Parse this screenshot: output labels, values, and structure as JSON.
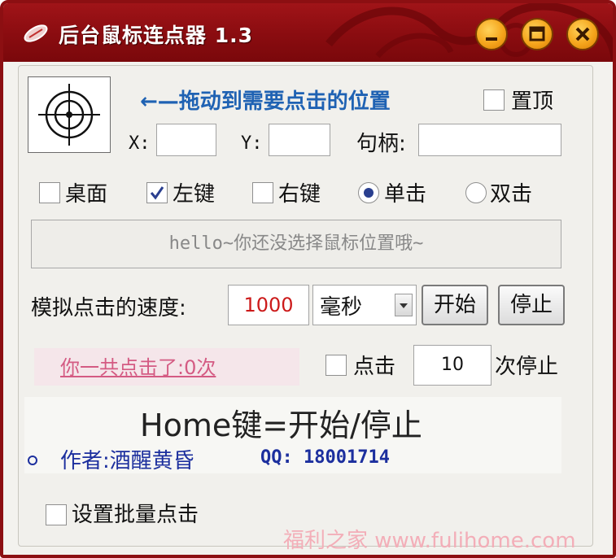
{
  "window": {
    "title": "后台鼠标连点器 1.3",
    "controls": [
      "minimize-button",
      "maximize-button",
      "close-button"
    ]
  },
  "target": {
    "drag_hint": "←—拖动到需要点击的位置",
    "always_on_top_label": "置顶",
    "x_label": "X:",
    "x_value": "",
    "y_label": "Y:",
    "y_value": "",
    "handle_label": "句柄:",
    "handle_value": ""
  },
  "options": {
    "desktop_label": "桌面",
    "desktop_checked": false,
    "left_key_label": "左键",
    "left_key_checked": true,
    "right_key_label": "右键",
    "right_key_checked": false,
    "single_click_label": "单击",
    "single_click_selected": true,
    "double_click_label": "双击",
    "double_click_selected": false
  },
  "status": {
    "message": "hello~你还没选择鼠标位置哦~"
  },
  "speed": {
    "label": "模拟点击的速度:",
    "value": "1000",
    "unit": "毫秒",
    "start_label": "开始",
    "stop_label": "停止"
  },
  "counter": {
    "text": "你一共点击了:0次",
    "stop_after_label": "点击",
    "stop_after_checked": false,
    "stop_after_value": "10",
    "stop_suffix": "次停止"
  },
  "info": {
    "home_key": "Home键=开始/停止",
    "author": "作者:酒醒黄昏",
    "qq": "QQ: 18001714"
  },
  "batch": {
    "label": "设置批量点击",
    "checked": false
  },
  "watermark": "福利之家 www.fulihome.com",
  "colors": {
    "titlebar": "#8a0c10",
    "accent_blue": "#1f62b3",
    "speed_red": "#cc1a1a",
    "link_pink": "#d45b83",
    "author_blue": "#1c2f9e"
  },
  "icons": [
    "mouse-app-icon",
    "crosshair-icon",
    "minimize-icon",
    "maximize-icon",
    "close-icon",
    "checkmark-icon",
    "dropdown-arrow-icon"
  ]
}
